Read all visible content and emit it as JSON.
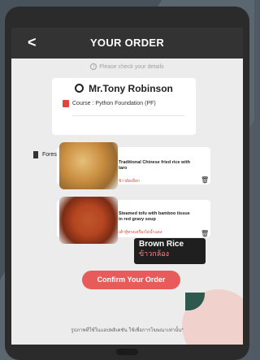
{
  "header": {
    "back_glyph": "<",
    "title": "YOUR ORDER"
  },
  "notice": "Please check your details",
  "user": {
    "name": "Mr.Tony Robinson",
    "course": "Course : Python Foundation (PF)",
    "room": "Forest Room"
  },
  "items": [
    {
      "name": "Traditional Chinese fried rice with taro",
      "thai": "ข้าวผัดเผือก"
    },
    {
      "name": "Steamed tofu with bamboo tissue in red gravy soup",
      "thai": "เต้าหู้ทรงเครื่องไผ่น้ำแดง"
    }
  ],
  "tooltip": {
    "en": "Brown Rice",
    "th": "ข้าวกล้อง"
  },
  "confirm_label": "Confirm Your Order",
  "footer_note": "รูปภาพที่ใช้ในแอปพลิเคชัน ใช้เพื่อการโฆษณาเท่านั้น*",
  "colors": {
    "accent": "#e85b5b",
    "header": "#333333"
  }
}
